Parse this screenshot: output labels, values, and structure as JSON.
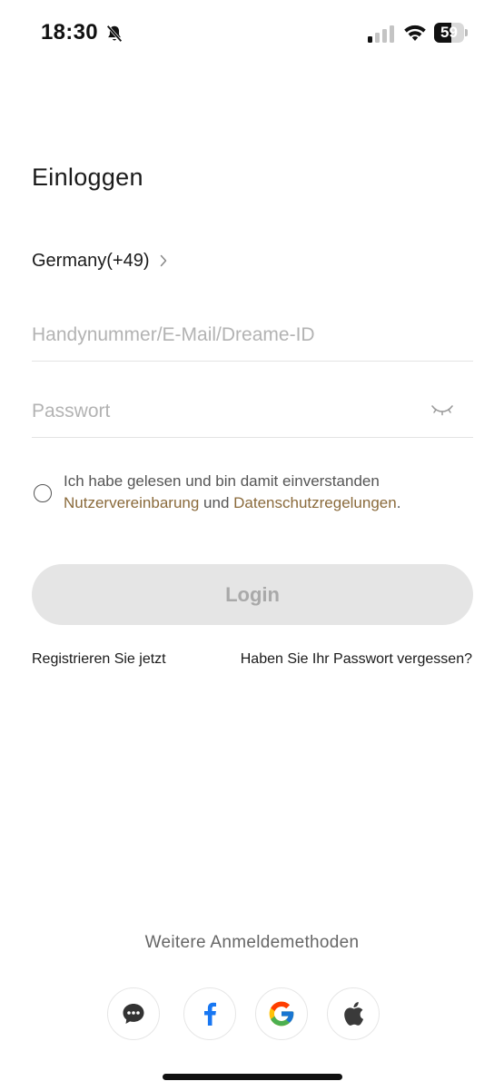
{
  "status_bar": {
    "time": "18:30",
    "battery_level": "59",
    "battery_fraction": 0.59
  },
  "login": {
    "title": "Einloggen",
    "country": "Germany(+49)",
    "account_placeholder": "Handynummer/E-Mail/Dreame-ID",
    "account_value": "",
    "password_placeholder": "Passwort",
    "password_value": "",
    "agreement": {
      "checked": false,
      "text_line1": "Ich habe gelesen und bin damit einverstanden",
      "link_terms": "Nutzervereinbarung",
      "connector": " und ",
      "link_privacy": "Datenschutzregelungen",
      "suffix": "."
    },
    "login_button": "Login",
    "register_link": "Registrieren Sie jetzt",
    "forgot_link": "Haben Sie Ihr Passwort vergessen?"
  },
  "other_methods": {
    "label": "Weitere Anmeldemethoden",
    "providers": [
      "chat-icon",
      "facebook-icon",
      "google-icon",
      "apple-icon"
    ]
  },
  "colors": {
    "link": "#8a6a3b",
    "button_disabled_bg": "#e5e5e5",
    "button_disabled_text": "#a9a9a9",
    "facebook": "#1877f2"
  }
}
